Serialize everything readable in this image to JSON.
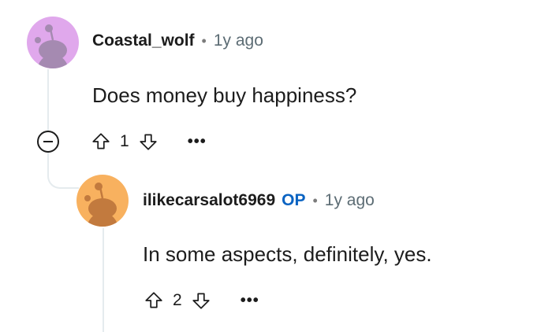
{
  "comments": [
    {
      "username": "Coastal_wolf",
      "separator": "•",
      "time": "1y ago",
      "body": "Does money buy happiness?",
      "score": "1",
      "avatar_color": "#e0a8ec",
      "more_label": "•••"
    },
    {
      "username": "ilikecarsalot6969",
      "op_badge": "OP",
      "separator": "•",
      "time": "1y ago",
      "body": "In some aspects, definitely, yes.",
      "score": "2",
      "avatar_color": "#f8b15f",
      "more_label": "•••"
    }
  ],
  "colors": {
    "thread_line": "#e5ebee",
    "op_badge": "#0a63c2",
    "meta_gray": "#5c6c74"
  },
  "icons": [
    "reddit-snoo-avatar",
    "upvote-arrow-icon",
    "downvote-arrow-icon",
    "collapse-minus-icon",
    "more-options-icon"
  ]
}
